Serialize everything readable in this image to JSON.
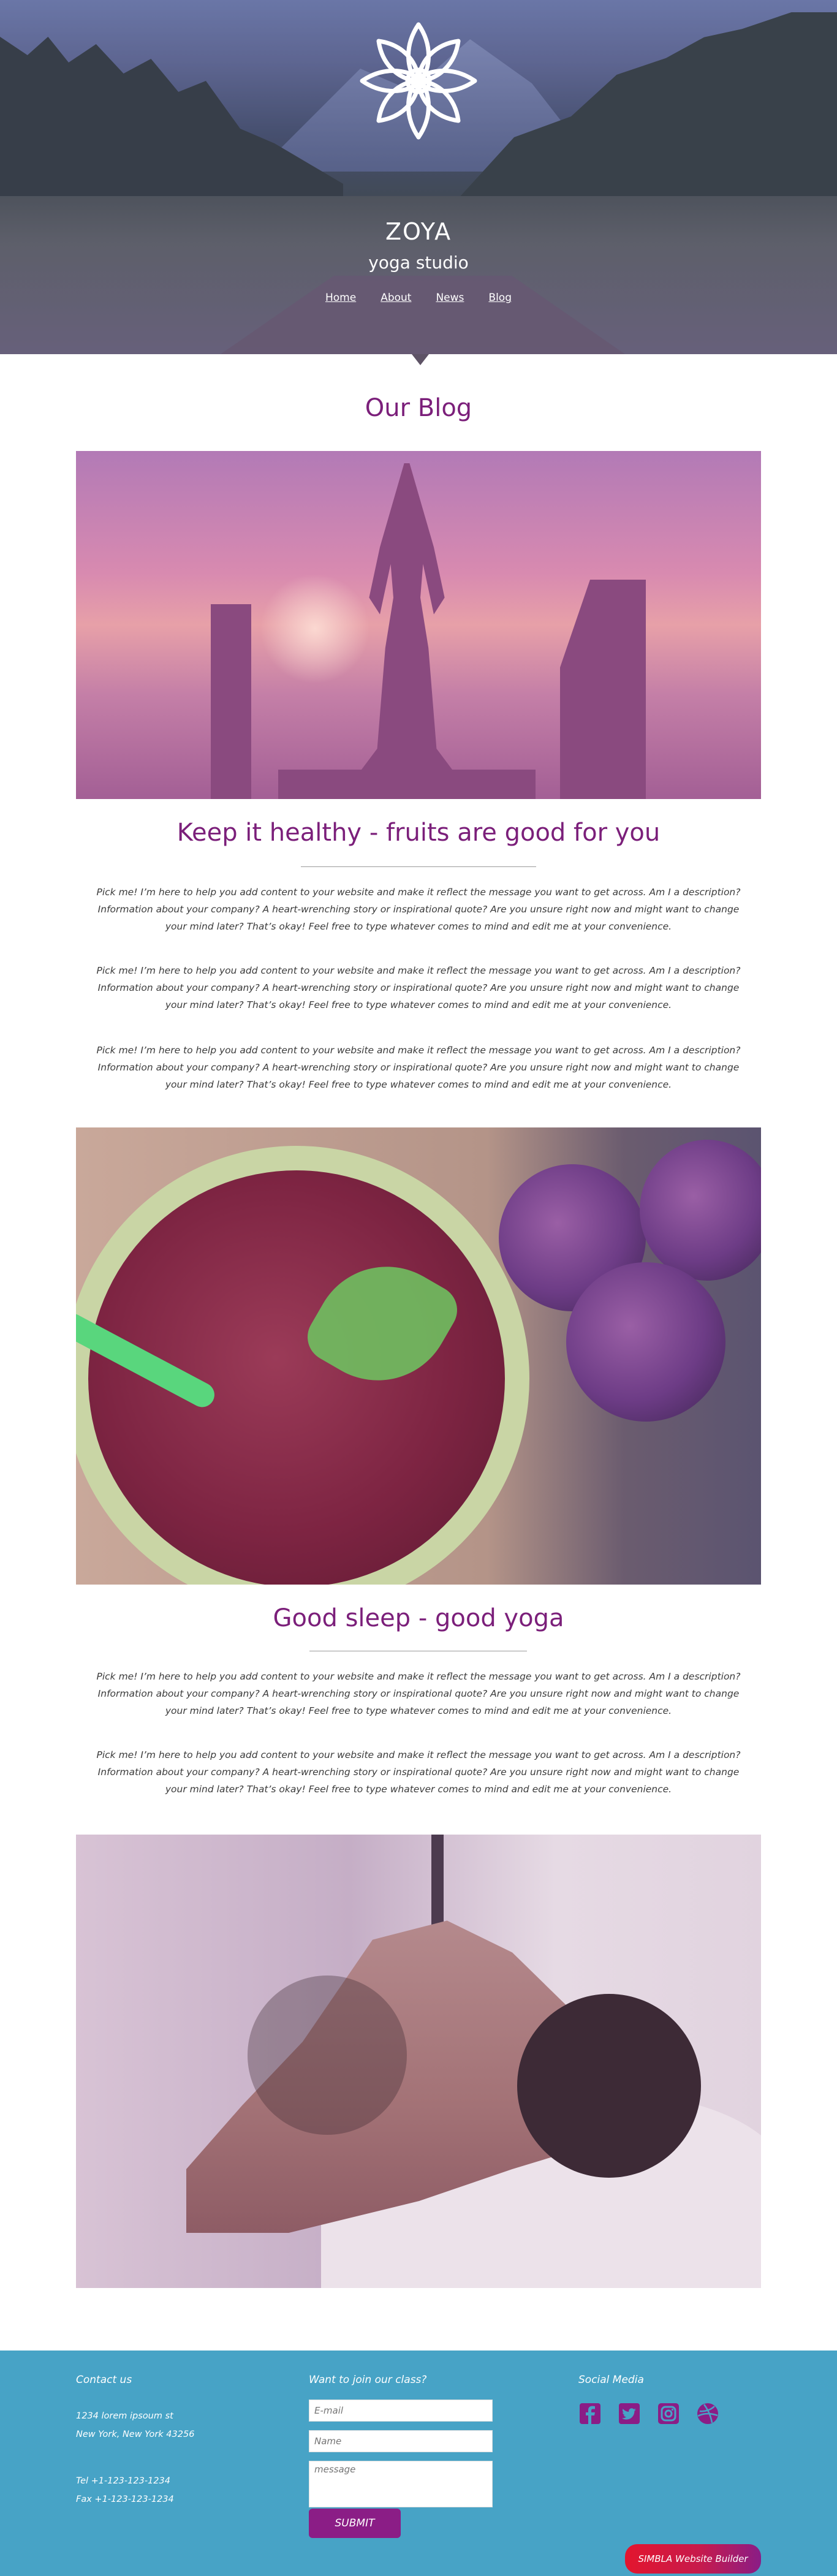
{
  "header": {
    "brand_name": "ZOYA",
    "tagline": "yoga studio",
    "nav": [
      {
        "label": "Home"
      },
      {
        "label": "About"
      },
      {
        "label": "News"
      },
      {
        "label": "Blog"
      }
    ]
  },
  "blog": {
    "title": "Our Blog",
    "posts": [
      {
        "title": "Keep it healthy - fruits are good for you",
        "paragraphs": [
          [
            "Pick me! I’m here to help you add content to your website and make it reflect the message you want to get across. Am I a description?",
            "Information about your company? A heart-wrenching story or inspirational quote? Are you unsure right now and might want to change",
            "your mind later? That’s okay! Feel free to type whatever comes to mind and edit me at your convenience."
          ],
          [
            "Pick me! I’m here to help you add content to your website and make it reflect the message you want to get across. Am I a description?",
            "Information about your company? A heart-wrenching story or inspirational quote? Are you unsure right now and might want to change",
            "your mind later? That’s okay! Feel free to type whatever comes to mind and edit me at your convenience."
          ],
          [
            "Pick me! I’m here to help you add content to your website and make it reflect the message you want to get across. Am I a description?",
            "Information about your company? A heart-wrenching story or inspirational quote? Are you unsure right now and might want to change",
            "your mind later? That’s okay! Feel free to type whatever comes to mind and edit me at your convenience."
          ]
        ]
      },
      {
        "title": "Good sleep - good yoga",
        "paragraphs": [
          [
            "Pick me! I’m here to help you add content to your website and make it reflect the message you want to get across. Am I a description?",
            "Information about your company? A heart-wrenching story or inspirational quote? Are you unsure right now and might want to change",
            "your mind later? That’s okay! Feel free to type whatever comes to mind and edit me at your convenience."
          ],
          [
            "Pick me! I’m here to help you add content to your website and make it reflect the message you want to get across. Am I a description?",
            "Information about your company? A heart-wrenching story or inspirational quote? Are you unsure right now and might want to change",
            "your mind later? That’s okay! Feel free to type whatever comes to mind and edit me at your convenience."
          ]
        ]
      }
    ]
  },
  "footer": {
    "contact_heading": "Contact us",
    "address_line1": "1234 lorem ipsoum st",
    "address_line2": "New York, New York 43256",
    "tel": "Tel +1-123-123-1234",
    "fax": "Fax +1-123-123-1234",
    "join_heading": "Want to join our class?",
    "email_placeholder": "E-mail",
    "name_placeholder": "Name",
    "message_placeholder": "message",
    "submit_label": "SUBMIT",
    "social_heading": "Social Media",
    "social_icons": [
      "facebook-icon",
      "twitter-icon",
      "instagram-icon",
      "dribbble-icon"
    ],
    "builder_badge": "SIMBLA Website Builder"
  },
  "colors": {
    "accent": "#7b1f7a",
    "footer_bg": "#47a3c6",
    "submit_bg": "#8b1d86",
    "badge_start": "#e3152e"
  }
}
